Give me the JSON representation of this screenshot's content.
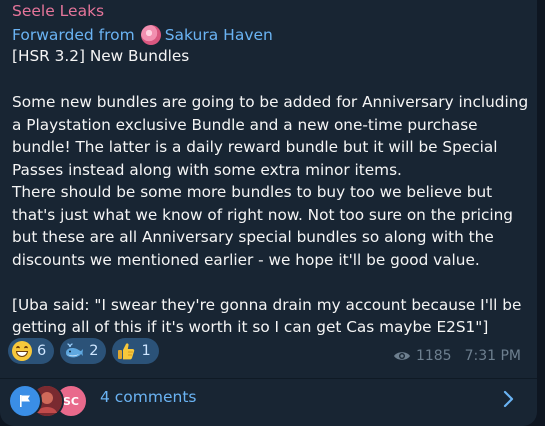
{
  "message": {
    "sender": "Seele Leaks",
    "forwarded_prefix": "Forwarded from",
    "forwarded_channel": "Sakura Haven",
    "title": "[HSR 3.2] New Bundles",
    "lines": [
      "Some new bundles are going to be added for Anniversary including",
      "a Playstation exclusive Bundle and a new one-time purchase",
      "bundle! The latter is a daily reward bundle but it will be Special",
      "Passes instead along with some extra minor items.",
      "There should be some more bundles to buy too we believe but",
      "that's just what we know of right now. Not too sure on the pricing",
      "but these are all Anniversary special bundles so along with the",
      "discounts we mentioned earlier - we hope it'll be good value."
    ],
    "quote_lines": [
      "[Uba said: \"I swear they're gonna drain my account because I'll be",
      "getting all of this if it's worth it so I can get Cas maybe E2S1\"]"
    ]
  },
  "reactions": [
    {
      "icon": "grinning-face-icon",
      "count": "6"
    },
    {
      "icon": "whale-icon",
      "count": "2"
    },
    {
      "icon": "thumbs-up-icon",
      "count": "1"
    }
  ],
  "meta": {
    "views": "1185",
    "time": "7:31 PM"
  },
  "comments": {
    "label": "4 comments",
    "avatar3_initials": "SC"
  },
  "colors": {
    "background": "#0e1621",
    "bubble": "#182533",
    "sender": "#e5759a",
    "link": "#6ab3f3",
    "reaction_bg": "#2b5278"
  }
}
